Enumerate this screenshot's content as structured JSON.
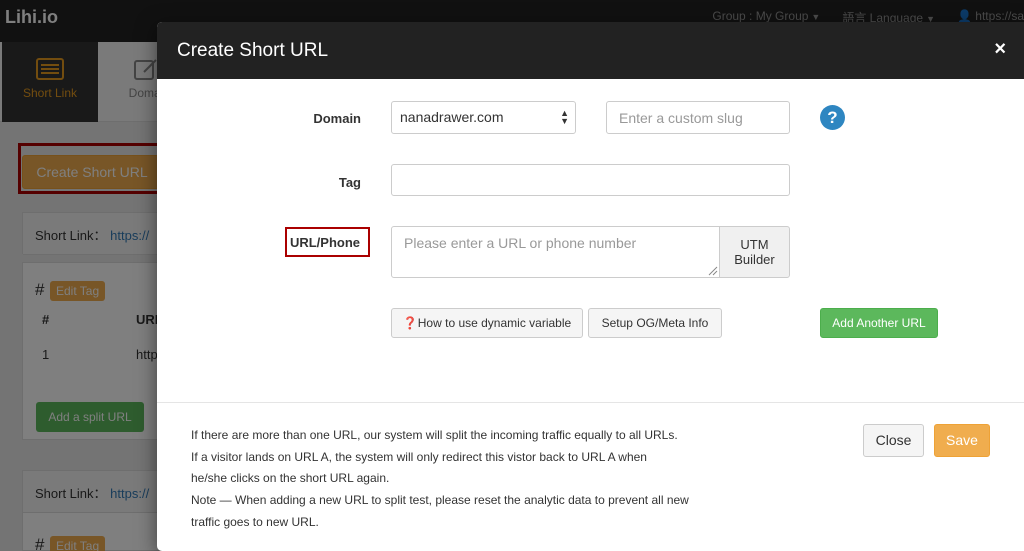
{
  "app": {
    "brand": "Lihi.io",
    "top_links": [
      "Group : My Group",
      "語言 Language",
      "https://sa"
    ]
  },
  "iconbar": {
    "items": [
      "Short Link",
      "Domai"
    ]
  },
  "background": {
    "create_button": "Create Short URL",
    "panel1": {
      "label": "Short Link：",
      "link": "https://"
    },
    "hash": "#",
    "edit_tag": "Edit Tag",
    "table_headers": [
      "#",
      "URL"
    ],
    "row_number": "1",
    "row_url": "http",
    "add_split": "Add a split URL",
    "panel2": {
      "label": "Short Link：",
      "link": "https://"
    },
    "hash2": "#",
    "edit_tag2": "Edit Tag"
  },
  "modal": {
    "title": "Create Short URL",
    "close_symbol": "×",
    "domain_label": "Domain",
    "domain_value": "nanadrawer.com",
    "slug_placeholder": "Enter a custom slug",
    "help_symbol": "?",
    "tag_label": "Tag",
    "tag_value": "",
    "url_label": "URL/Phone",
    "url_placeholder": "Please enter a URL or phone number",
    "utm_line1": "UTM",
    "utm_line2": "Builder",
    "dynamic_btn": "How to use dynamic variable",
    "og_btn": "Setup OG/Meta Info",
    "add_another": "Add Another URL",
    "footer_lines": [
      "If there are more than one URL, our system will split the incoming traffic equally to all URLs.",
      "If a visitor lands on URL A, the system will only redirect this vistor back to URL A when",
      "he/she clicks on the short URL again.",
      "Note — When adding a new URL to split test, please reset the analytic data to prevent all new",
      "traffic goes to new URL."
    ],
    "close_btn": "Close",
    "save_btn": "Save"
  },
  "colors": {
    "header": "#222222",
    "accent_orange": "#f0ad4e",
    "green": "#5cb85c",
    "highlight_red": "#aa0000",
    "help_blue": "#2e86c1"
  }
}
